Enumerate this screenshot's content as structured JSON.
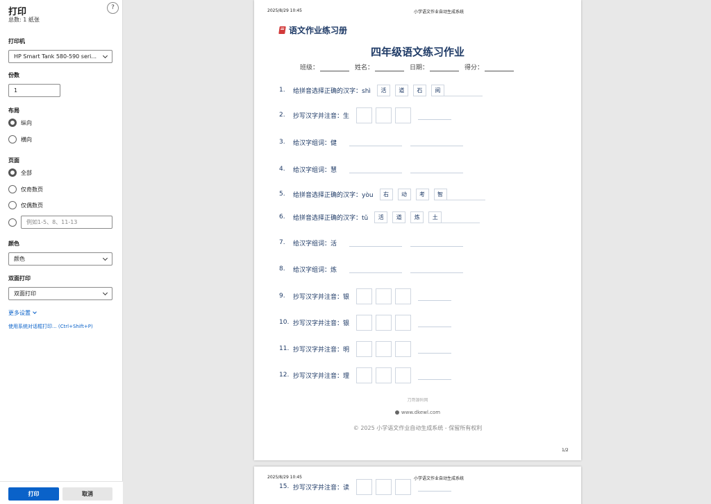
{
  "panel": {
    "title": "打印",
    "subtitle": "总数: 1 纸张",
    "help": "?",
    "printer": {
      "label": "打印机",
      "value": "HP Smart Tank 580-590 seri..."
    },
    "copies": {
      "label": "份数",
      "value": "1"
    },
    "layout": {
      "label": "布局",
      "options": [
        "纵向",
        "横向"
      ],
      "selected": 0
    },
    "pages": {
      "label": "页面",
      "options": [
        "全部",
        "仅奇数页",
        "仅偶数页"
      ],
      "selected": 0,
      "range_placeholder": "例如1-5、8、11-13"
    },
    "color": {
      "label": "颜色",
      "value": "颜色"
    },
    "duplex": {
      "label": "双面打印",
      "value": "双面打印"
    },
    "more_settings": "更多设置",
    "system_dialog": "使用系统对话框打印... (Ctrl+Shift+P)",
    "print_btn": "打印",
    "cancel_btn": "取消"
  },
  "page1": {
    "header_time": "2025/8/29 10:45",
    "header_system": "小学语文作业自动生成系统",
    "brand": "语文作业练习册",
    "title": "四年级语文练习作业",
    "info": [
      "班级：",
      "姓名：",
      "日期：",
      "得分："
    ],
    "questions": [
      {
        "num": "1.",
        "text": "给拼音选择正确的汉字：shì",
        "options": [
          "活",
          "道",
          "石",
          "阅"
        ]
      },
      {
        "num": "2.",
        "text": "抄写汉字并注音：生"
      },
      {
        "num": "3.",
        "text": "给汉字组词：健"
      },
      {
        "num": "4.",
        "text": "给汉字组词：慧"
      },
      {
        "num": "5.",
        "text": "给拼音选择正确的汉字：yòu",
        "options": [
          "右",
          "动",
          "考",
          "智"
        ]
      },
      {
        "num": "6.",
        "text": "给拼音选择正确的汉字：tǔ",
        "options": [
          "活",
          "道",
          "炼",
          "土"
        ]
      },
      {
        "num": "7.",
        "text": "给汉字组词：活"
      },
      {
        "num": "8.",
        "text": "给汉字组词：炼"
      },
      {
        "num": "9.",
        "text": "抄写汉字并注音：银"
      },
      {
        "num": "10.",
        "text": "抄写汉字并注音：银"
      },
      {
        "num": "11.",
        "text": "抄写汉字并注音：明"
      },
      {
        "num": "12.",
        "text": "抄写汉字并注音：理"
      }
    ],
    "footer_small": "刀哥源码网",
    "footer_url": "www.dkewl.com",
    "footer_copyright": "© 2025 小学语文作业自动生成系统 - 保留所有权利",
    "page_number": "1/2"
  },
  "page2": {
    "header_time": "2025/8/29 10:45",
    "header_system": "小学语文作业自动生成系统",
    "question": {
      "num": "15.",
      "text": "抄写汉字并注音：读"
    }
  }
}
